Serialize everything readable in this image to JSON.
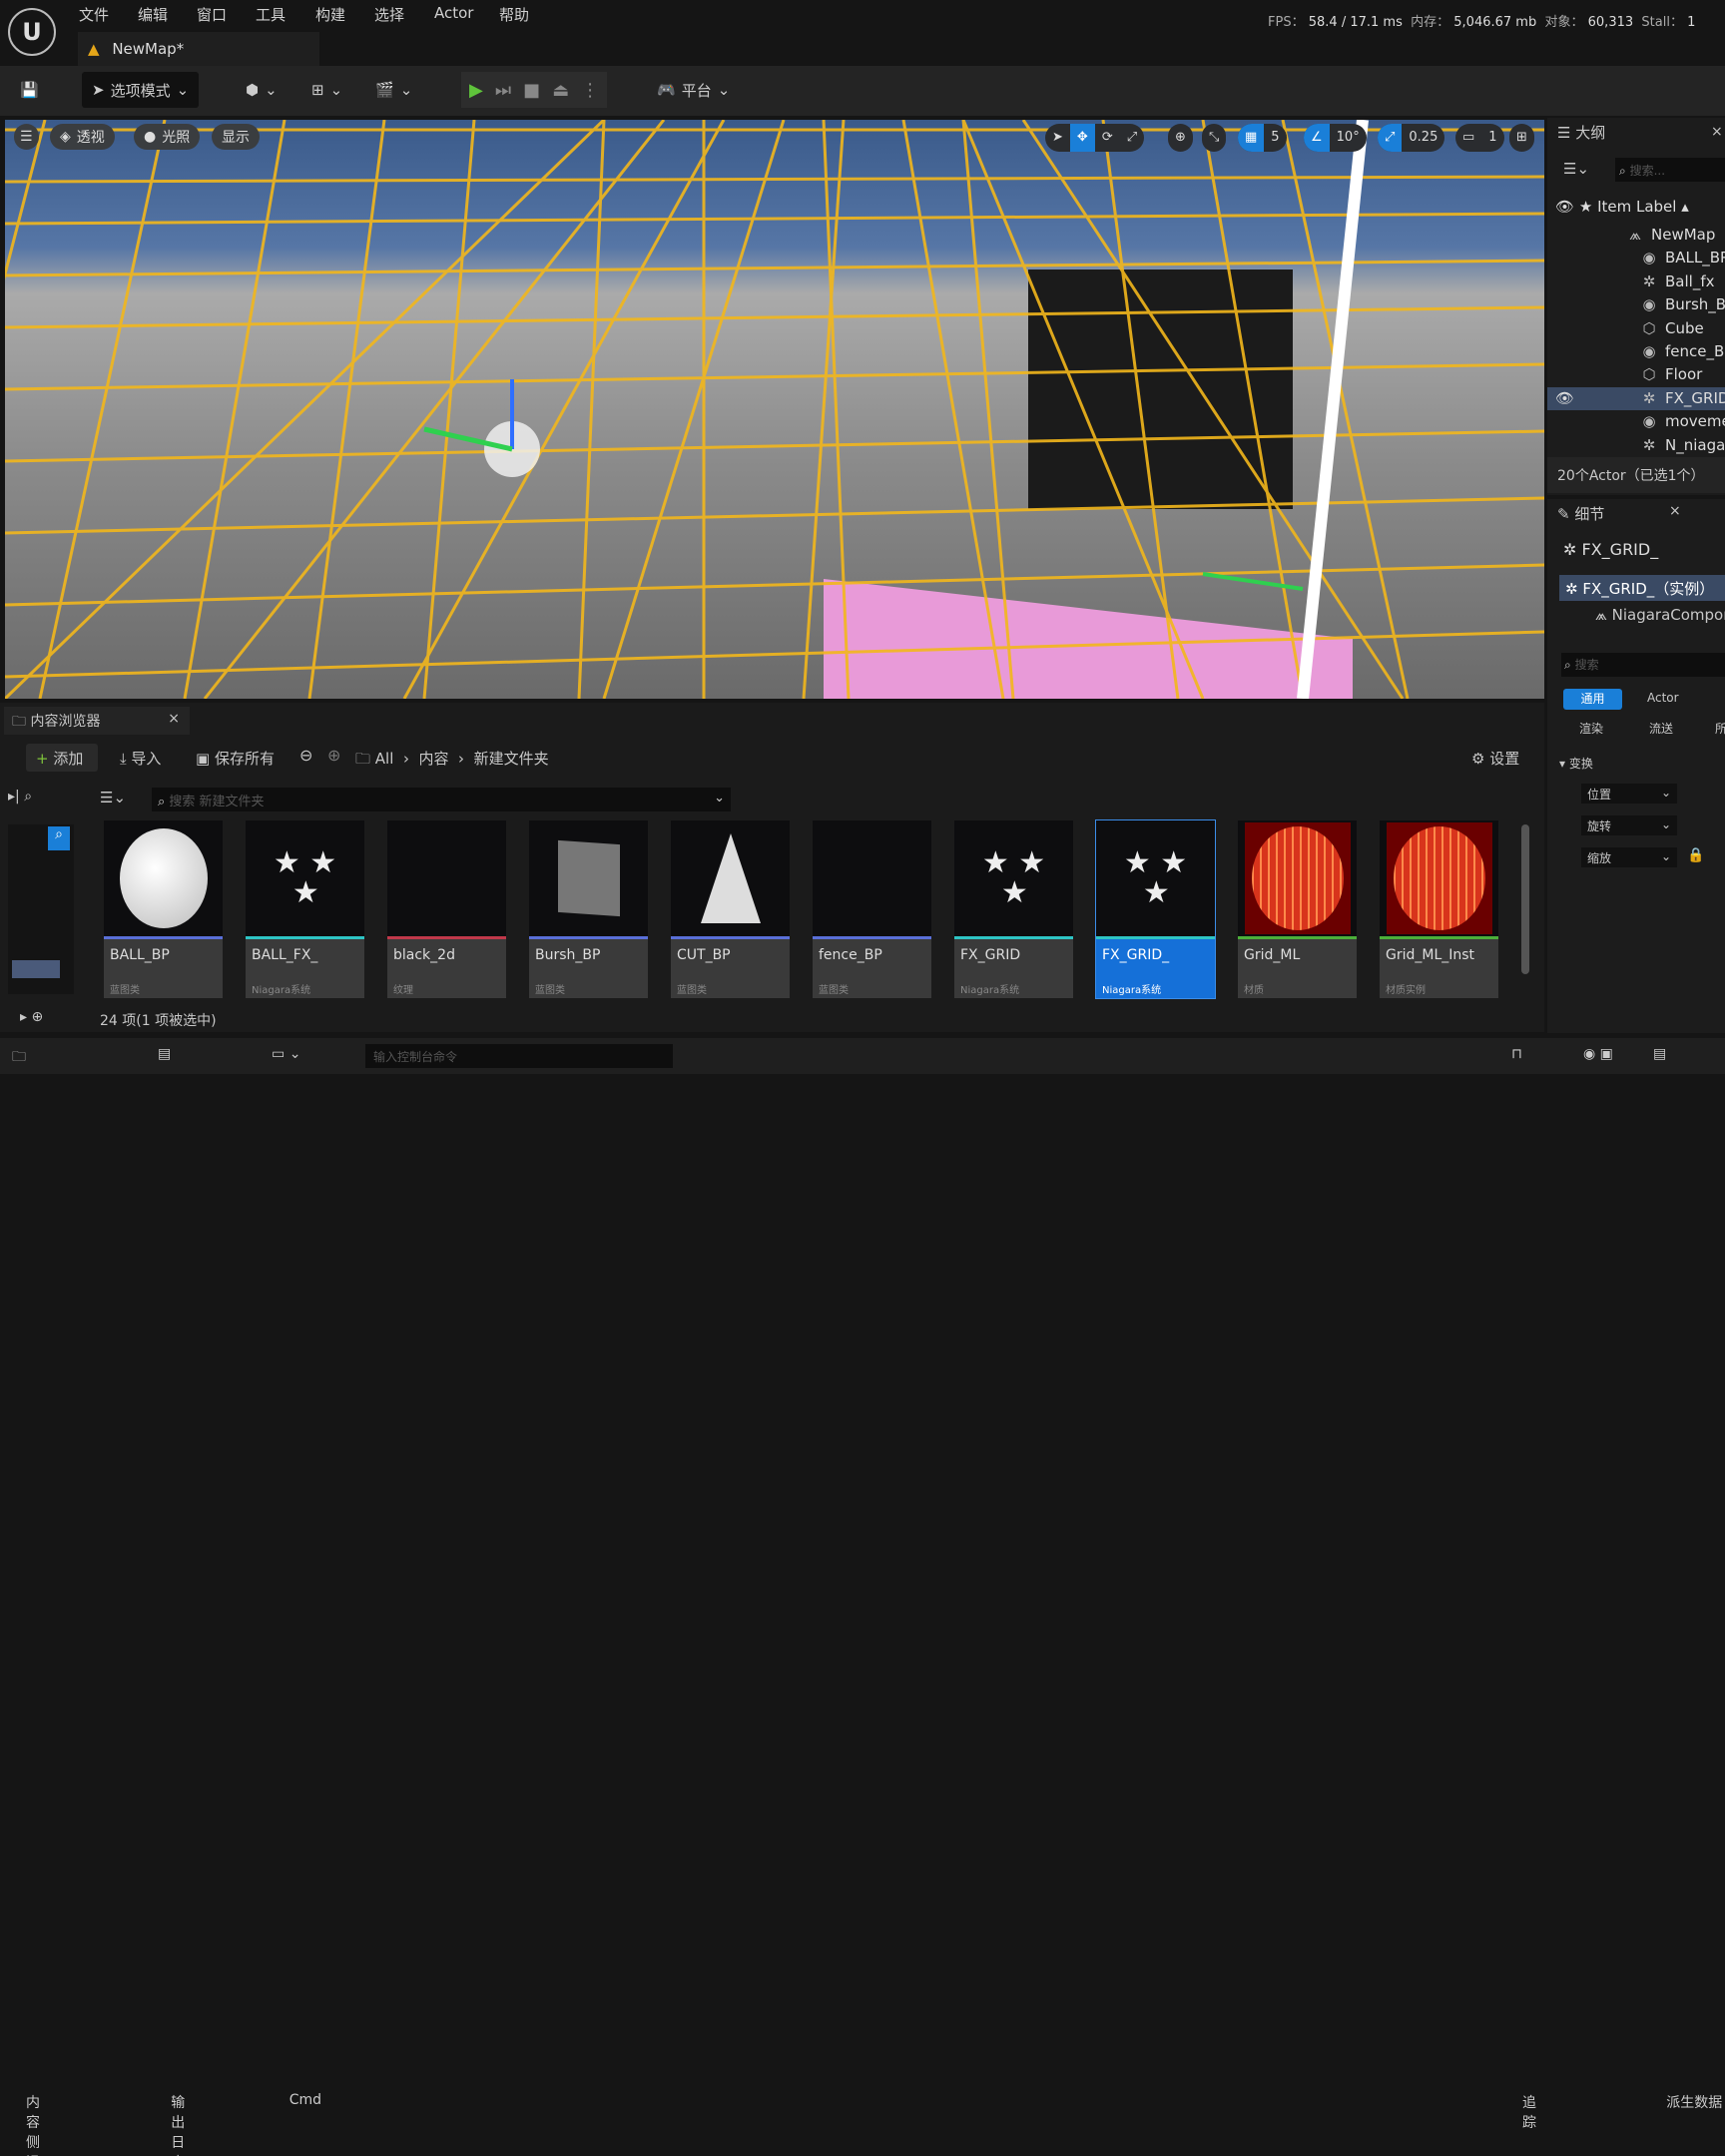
{
  "menu": {
    "items": [
      "文件",
      "编辑",
      "窗口",
      "工具",
      "构建",
      "选择",
      "Actor",
      "帮助"
    ]
  },
  "tab": {
    "title": "NewMap*"
  },
  "stats": {
    "fps_label": "FPS：",
    "fps": "58.4",
    "frame": "/ 17.1 ms",
    "mem_label": "内存：",
    "mem": "5,046.67 mb",
    "obj_label": "对象：",
    "objects": "60,313",
    "stall_label": "Stall：",
    "stall": "1"
  },
  "toolbar": {
    "mode": "选项模式",
    "platform": "平台"
  },
  "viewport": {
    "view": "透视",
    "lighting": "光照",
    "show": "显示",
    "grid_snap": "5",
    "rot_snap": "10°",
    "scale_snap": "0.25",
    "camera_speed": "1"
  },
  "outliner": {
    "title": "大纲",
    "search_placeholder": "搜索...",
    "column": "Item Label",
    "items": [
      {
        "label": "NewMap",
        "icon": "map-icon"
      },
      {
        "label": "BALL_BP",
        "icon": "blueprint-icon"
      },
      {
        "label": "Ball_fx",
        "icon": "niagara-icon"
      },
      {
        "label": "Bursh_BP",
        "icon": "blueprint-icon"
      },
      {
        "label": "Cube",
        "icon": "mesh-icon"
      },
      {
        "label": "fence_BP",
        "icon": "blueprint-icon"
      },
      {
        "label": "Floor",
        "icon": "mesh-icon"
      },
      {
        "label": "FX_GRID_",
        "icon": "niagara-icon",
        "selected": true
      },
      {
        "label": "movement",
        "icon": "blueprint-icon"
      },
      {
        "label": "N_niagara",
        "icon": "niagara-icon"
      }
    ],
    "footer": "20个Actor（已选1个）"
  },
  "details": {
    "title": "细节",
    "actor": "FX_GRID_",
    "instance": "FX_GRID_（实例）",
    "component": "NiagaraComponent",
    "search_placeholder": "搜索",
    "tabs": [
      "通用",
      "Actor",
      "渲染",
      "流送",
      "所"
    ],
    "section": "变换",
    "rows": [
      "位置",
      "旋转",
      "缩放"
    ]
  },
  "content_browser": {
    "title": "内容浏览器",
    "add": "添加",
    "import": "导入",
    "save_all": "保存所有",
    "path": [
      "All",
      "内容",
      "新建文件夹"
    ],
    "settings": "设置",
    "search_placeholder": "搜索 新建文件夹",
    "status": "24 项(1 项被选中)",
    "assets": [
      {
        "name": "BALL_BP",
        "type": "蓝图类",
        "color": "#5a6fd8",
        "thumb": "sphere"
      },
      {
        "name": "BALL_FX_",
        "type": "Niagara系统",
        "color": "#2ec4c4",
        "thumb": "stars"
      },
      {
        "name": "black_2d",
        "type": "纹理",
        "color": "#c0384a",
        "thumb": "black"
      },
      {
        "name": "Bursh_BP",
        "type": "蓝图类",
        "color": "#5a6fd8",
        "thumb": "plane"
      },
      {
        "name": "CUT_BP",
        "type": "蓝图类",
        "color": "#5a6fd8",
        "thumb": "cone"
      },
      {
        "name": "fence_BP",
        "type": "蓝图类",
        "color": "#5a6fd8",
        "thumb": "black"
      },
      {
        "name": "FX_GRID",
        "type": "Niagara系统",
        "color": "#2ec4c4",
        "thumb": "stars"
      },
      {
        "name": "FX_GRID_",
        "type": "Niagara系统",
        "color": "#2ec4c4",
        "thumb": "stars",
        "selected": true
      },
      {
        "name": "Grid_ML",
        "type": "材质",
        "color": "#4caf3a",
        "thumb": "redsphere"
      },
      {
        "name": "Grid_ML_Inst",
        "type": "材质实例",
        "color": "#4caf3a",
        "thumb": "redsphere"
      }
    ]
  },
  "bottom": {
    "drawer": "内容侧滑菜单",
    "log": "输出日志",
    "cmd": "Cmd",
    "cmd_placeholder": "输入控制台命令",
    "trace": "追踪",
    "derived": "派生数据"
  },
  "colors": {
    "accent": "#1a7fd8",
    "play": "#5fc33b",
    "grid": "#f2b71c"
  }
}
